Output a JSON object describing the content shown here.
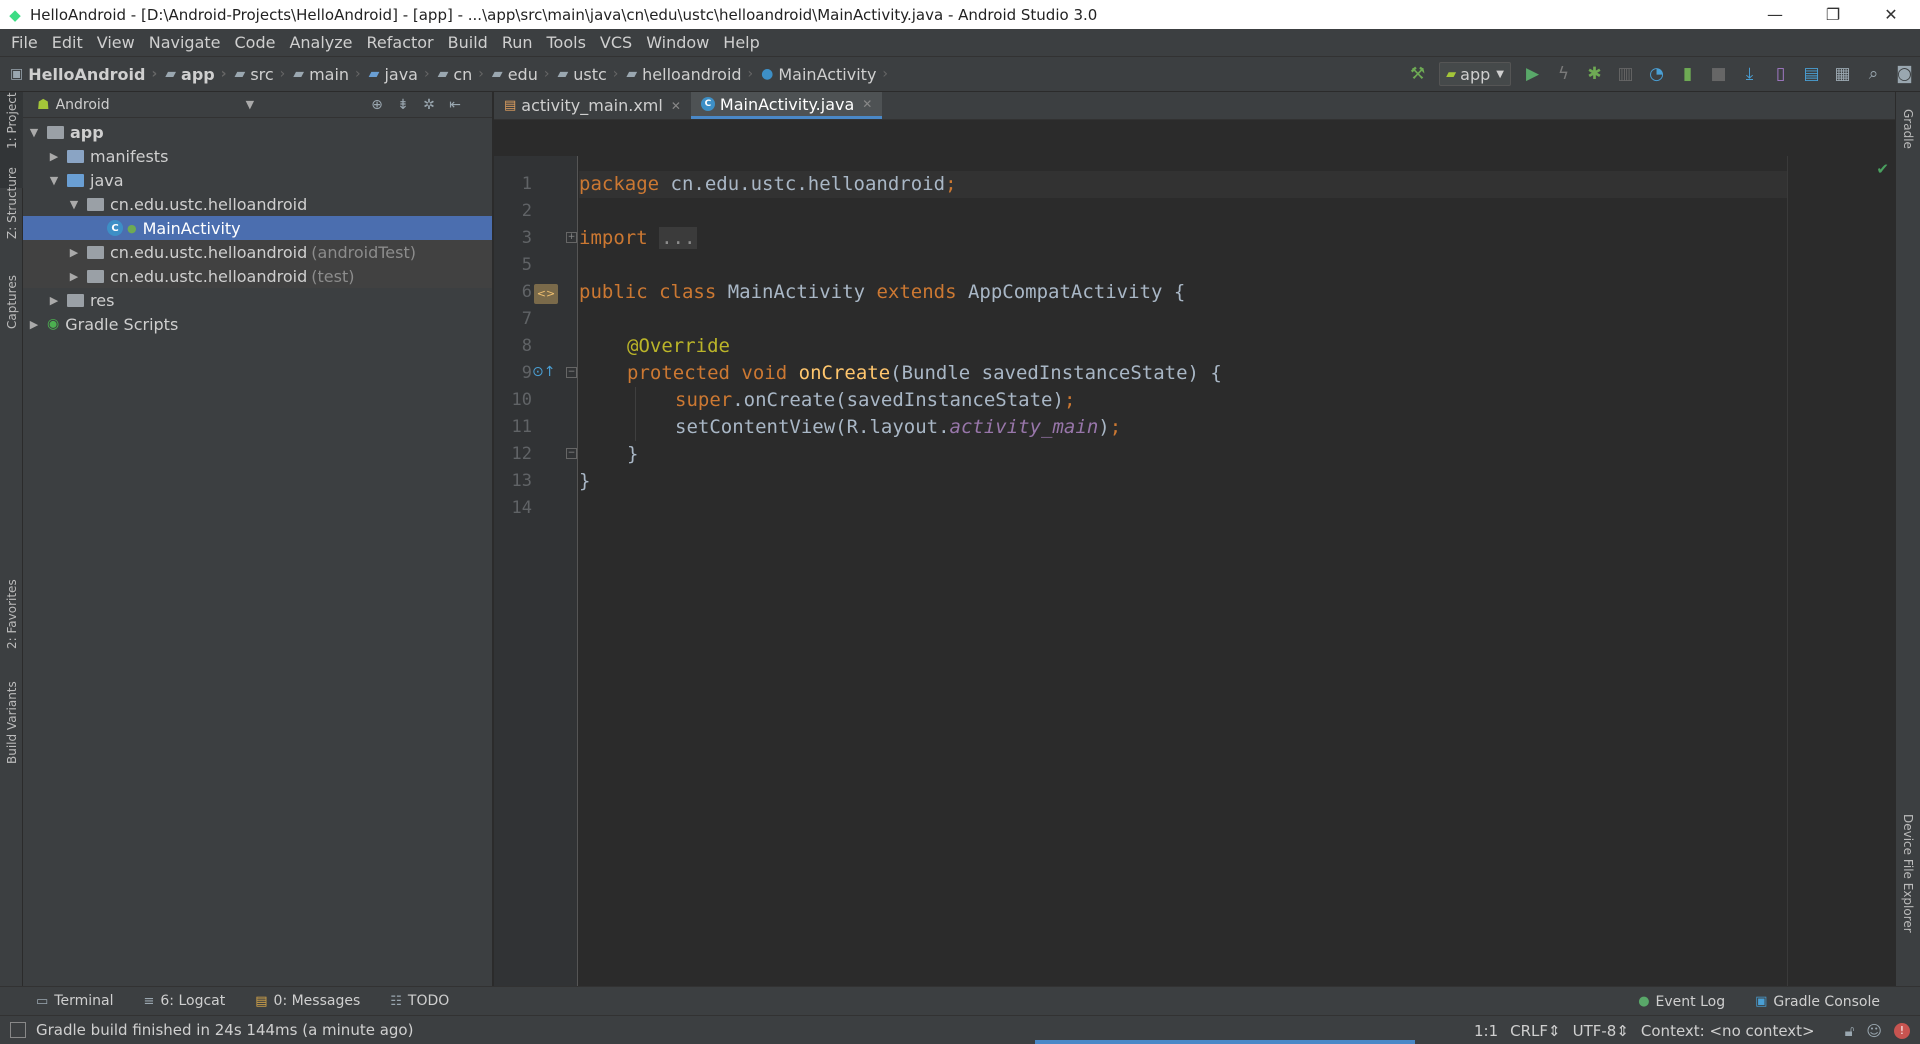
{
  "window": {
    "title": "HelloAndroid - [D:\\Android-Projects\\HelloAndroid] - [app] - ...\\app\\src\\main\\java\\cn\\edu\\ustc\\helloandroid\\MainActivity.java - Android Studio 3.0",
    "minimize": "—",
    "restore": "❐",
    "close": "✕"
  },
  "menu": [
    "File",
    "Edit",
    "View",
    "Navigate",
    "Code",
    "Analyze",
    "Refactor",
    "Build",
    "Run",
    "Tools",
    "VCS",
    "Window",
    "Help"
  ],
  "nav": {
    "crumbs": [
      "HelloAndroid",
      "app",
      "src",
      "main",
      "java",
      "cn",
      "edu",
      "ustc",
      "helloandroid",
      "MainActivity"
    ],
    "run_config": "app"
  },
  "left_strip": {
    "project": "1: Project",
    "structure": "Z: Structure",
    "captures": "Captures",
    "favorites": "2: Favorites",
    "build_variants": "Build Variants"
  },
  "right_strip": {
    "gradle": "Gradle",
    "device_file_explorer": "Device File Explorer"
  },
  "project_panel": {
    "view": "Android",
    "tree": {
      "app": "app",
      "manifests": "manifests",
      "java": "java",
      "pkg_main": "cn.edu.ustc.helloandroid",
      "main_activity": "MainActivity",
      "pkg_android_test": "cn.edu.ustc.helloandroid",
      "android_test_suffix": "(androidTest)",
      "pkg_test": "cn.edu.ustc.helloandroid",
      "test_suffix": "(test)",
      "res": "res",
      "gradle_scripts": "Gradle Scripts"
    }
  },
  "tabs": [
    {
      "label": "activity_main.xml"
    },
    {
      "label": "MainActivity.java"
    }
  ],
  "code": {
    "line_numbers": [
      "1",
      "2",
      "3",
      "5",
      "6",
      "7",
      "8",
      "9",
      "10",
      "11",
      "12",
      "13",
      "14"
    ],
    "l1_kw": "package",
    "l1_rest": " cn.edu.ustc.helloandroid",
    "l1_semi": ";",
    "l3_kw": "import",
    "l3_fold": "...",
    "l6_kw1": "public",
    "l6_kw2": "class",
    "l6_name": " MainActivity ",
    "l6_kw3": "extends",
    "l6_rest": " AppCompatActivity {",
    "l8_ann": "@Override",
    "l9_kw1": "protected",
    "l9_kw2": "void",
    "l9_fn": "onCreate",
    "l9_rest": "(Bundle savedInstanceState) {",
    "l10_kw": "super",
    "l10_rest": ".onCreate(savedInstanceState)",
    "l10_semi": ";",
    "l11_pre": "setContentView(R.layout.",
    "l11_st": "activity_main",
    "l11_post": ")",
    "l11_semi": ";",
    "l12": "}",
    "l13": "}"
  },
  "bottom_tools": {
    "terminal": "Terminal",
    "logcat": "6: Logcat",
    "messages": "0: Messages",
    "todo": "TODO",
    "event_log": "Event Log",
    "gradle_console": "Gradle Console"
  },
  "status": {
    "message": "Gradle build finished in 24s 144ms (a minute ago)",
    "position": "1:1",
    "line_sep": "CRLF⇕",
    "encoding": "UTF-8⇕",
    "context": "Context: <no context>"
  }
}
